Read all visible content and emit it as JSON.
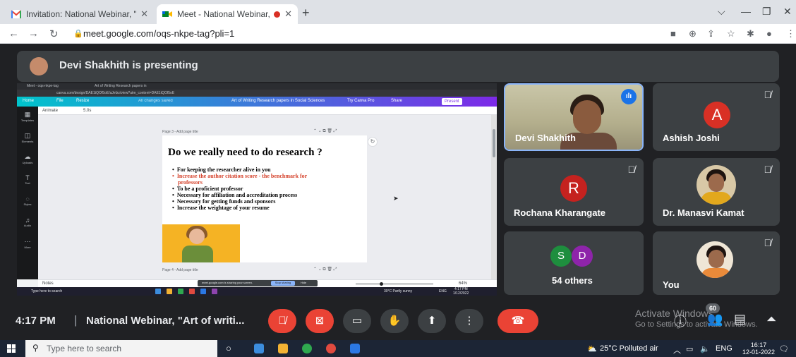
{
  "browser": {
    "tabs": [
      {
        "title": "Invitation: National Webinar, \"Art",
        "icon": "gmail-icon",
        "active": false
      },
      {
        "title": "Meet - National Webinar, \"A",
        "icon": "meet-icon",
        "active": true,
        "recording": true
      }
    ],
    "address": "meet.google.com/oqs-nkpe-tag?pli=1"
  },
  "presenting_banner": "Devi Shakhith is presenting",
  "shared_screen": {
    "browser_tabs": [
      "Meet - oqs-nkpe-tag",
      "Art of Writing Research papers in"
    ],
    "address": "canva.com/design/DAE1tQOf5oE/aJefzz/view?utm_content=DAE1tQOf5oE",
    "canva_toolbar": {
      "home": "Home",
      "file": "File",
      "resize": "Resize",
      "saved": "All changes saved",
      "doc_title": "Art of Writing Research papers in Social Sciences",
      "try_pro": "Try Canva Pro",
      "share": "Share",
      "present": "Present"
    },
    "sidebar": [
      "Templates",
      "Elements",
      "Uploads",
      "Text",
      "Styles",
      "Audio",
      "More"
    ],
    "animate": "Animate",
    "duration": "5.0s",
    "page3_label": "Page 3 - Add page title",
    "page4_label": "Page 4 - Add page title",
    "slide": {
      "heading": "Do we really need to do research ?",
      "bullets": [
        {
          "text": "For keeping the researcher alive in you",
          "highlight": false
        },
        {
          "text": "Increase the author citation score - the benchmark for",
          "highlight": true
        },
        {
          "text": "professors",
          "highlight": true,
          "continuation": true
        },
        {
          "text": "To be a proficient professor",
          "highlight": false
        },
        {
          "text": "Necessary for affiliation and accreditation process",
          "highlight": false
        },
        {
          "text": "Necessary for getting funds and sponsors",
          "highlight": false
        },
        {
          "text": "Increase the weightage of your resume",
          "highlight": false
        }
      ]
    },
    "notes": "Notes",
    "share_bar": {
      "text": "meet.google.com is sharing your screen.",
      "stop": "Stop sharing",
      "hide": "Hide"
    },
    "zoom": "64%",
    "taskbar": {
      "search": "Type here to search",
      "weather": "30°C Partly sunny",
      "lang": "ENG",
      "time": "4:17 PM",
      "date": "1/12/2022"
    }
  },
  "participants": [
    {
      "name": "Devi Shakhith",
      "type": "video",
      "speaking": true
    },
    {
      "name": "Ashish Joshi",
      "type": "initial",
      "initial": "A",
      "color": "#d93025",
      "muted": true
    },
    {
      "name": "Rochana Kharangate",
      "type": "initial",
      "initial": "R",
      "color": "#c5221f",
      "muted": true
    },
    {
      "name": "Dr. Manasvi Kamat",
      "type": "photo",
      "muted": true
    },
    {
      "name": "54 others",
      "type": "group",
      "initials": [
        "S",
        "D"
      ],
      "colors": [
        "#1e8e3e",
        "#8e24aa"
      ]
    },
    {
      "name": "You",
      "type": "photo",
      "muted": true
    }
  ],
  "controls": {
    "time": "4:17 PM",
    "separator": "|",
    "meeting_title": "National Webinar, \"Art of writi...",
    "participant_count": "60"
  },
  "watermark": {
    "line1": "Activate Windows",
    "line2": "Go to Settings to activate Windows."
  },
  "taskbar": {
    "search": "Type here to search",
    "weather": "25°C Polluted air",
    "lang": "ENG",
    "time": "16:17",
    "date": "12-01-2022"
  }
}
